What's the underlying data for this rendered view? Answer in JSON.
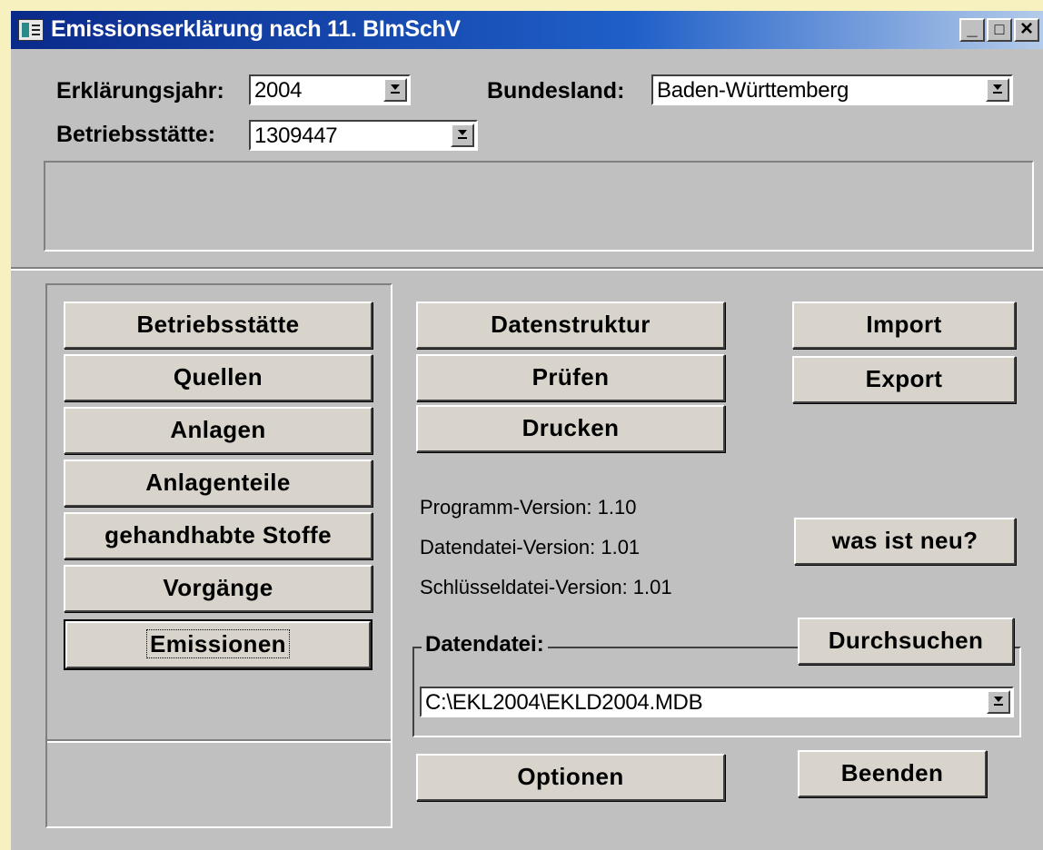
{
  "window": {
    "title": "Emissionserklärung nach 11. BImSchV"
  },
  "title_controls": {
    "minimize": "_",
    "maximize": "□",
    "close": "×"
  },
  "filters": {
    "year_label": "Erklärungsjahr:",
    "year_value": "2004",
    "state_label": "Bundesland:",
    "state_value": "Baden-Württemberg",
    "site_label": "Betriebsstätte:",
    "site_value": "1309447"
  },
  "nav_buttons": [
    "Betriebsstätte",
    "Quellen",
    "Anlagen",
    "Anlagenteile",
    "gehandhabte Stoffe",
    "Vorgänge",
    "Emissionen"
  ],
  "middle_buttons": [
    "Datenstruktur",
    "Prüfen",
    "Drucken"
  ],
  "right_buttons": {
    "import": "Import",
    "export": "Export",
    "whats_new": "was ist neu?"
  },
  "versions": {
    "program": "Programm-Version: 1.10",
    "datafile": "Datendatei-Version: 1.01",
    "keyfile": "Schlüsseldatei-Version: 1.01"
  },
  "datafile": {
    "label": "Datendatei:",
    "browse": "Durchsuchen",
    "path": "C:\\EKL2004\\EKLD2004.MDB"
  },
  "bottom_buttons": {
    "options": "Optionen",
    "quit": "Beenden"
  }
}
